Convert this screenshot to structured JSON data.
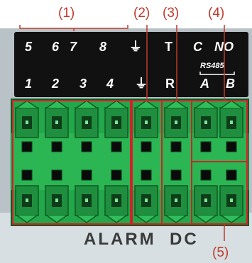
{
  "callouts": {
    "c1": "(1)",
    "c2": "(2)",
    "c3": "(3)",
    "c4": "(4)",
    "c5": "(5)"
  },
  "top_row_labels": [
    "5",
    "6",
    "7",
    "8",
    "⏚",
    "T",
    "C",
    "NO"
  ],
  "bottom_row_labels": [
    "1",
    "2",
    "3",
    "4",
    "⏚",
    "R",
    "A",
    "B"
  ],
  "rs485_label": "RS485",
  "bottom_label": "ALARM  DC",
  "colors": {
    "callout": "#c0392b",
    "panel": "#111111",
    "panel_text": "#ffffff",
    "connector": "#22a74a",
    "connector_dark": "#0f5a22",
    "housing_bg": "#cfd8dc",
    "outline_red": "#d4202a"
  },
  "icons": {
    "ground": "ground-icon",
    "terminal": "terminal-screw-icon"
  }
}
